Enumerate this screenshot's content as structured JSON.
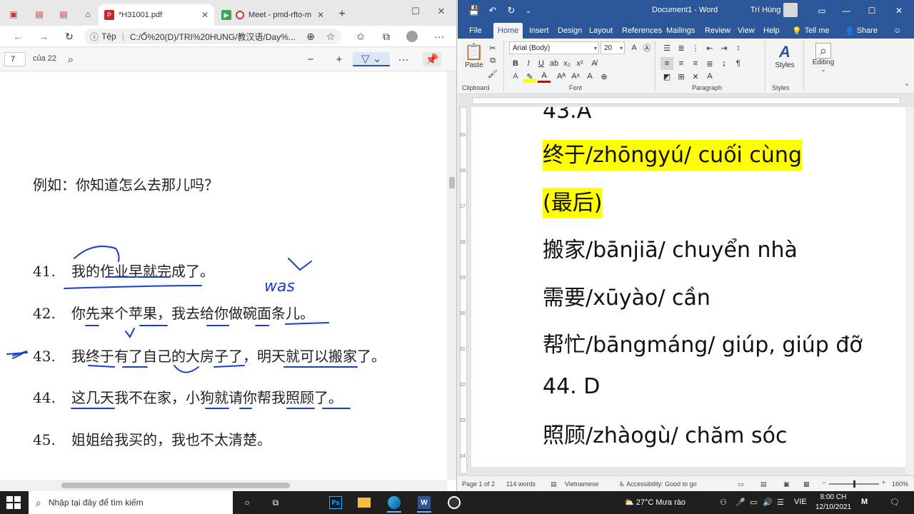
{
  "browser": {
    "tabs": [
      {
        "label": "*H31001.pdf",
        "active": true
      },
      {
        "label": "Meet - pmd-rfto-m",
        "active": false
      }
    ],
    "new_tab": "+",
    "address": {
      "label": "Tệp",
      "url": "C:/Ổ%20(D)/TRI%20HUNG/教汉语/Day%..."
    },
    "pdf": {
      "page_number": "7",
      "page_total": "của 22",
      "lines": [
        {
          "num": "",
          "text": "例如：你知道怎么去那儿吗？"
        },
        {
          "num": "41.",
          "text": "我的作业早就完成了。"
        },
        {
          "num": "42.",
          "text": "你先来个苹果，我去给你做碗面条儿。"
        },
        {
          "num": "43.",
          "text": "我终于有了自己的大房子了，明天就可以搬家了。"
        },
        {
          "num": "44.",
          "text": "这几天我不在家，小狗就请你帮我照顾了。"
        },
        {
          "num": "45.",
          "text": "姐姐给我买的，我也不太清楚。"
        }
      ],
      "handwriting": "was"
    }
  },
  "word": {
    "title": "Document1 - Word",
    "user": "Trí Hùng",
    "tabs": [
      "File",
      "Home",
      "Insert",
      "Design",
      "Layout",
      "References",
      "Mailings",
      "Review",
      "View",
      "Help",
      "Tell me",
      "Share"
    ],
    "font_name": "Arial (Body)",
    "font_size": "20",
    "groups": [
      "Clipboard",
      "Font",
      "Paragraph",
      "Styles"
    ],
    "paste_label": "Paste",
    "styles_label": "Styles",
    "editing_label": "Editing",
    "ruler_numbers": [
      "15",
      "16",
      "17",
      "18",
      "19",
      "20",
      "21",
      "22",
      "23",
      "24"
    ],
    "document_lines": [
      {
        "text": "43.A",
        "highlight": false
      },
      {
        "text": "终于/zhōngyú/ cuối cùng",
        "highlight": true
      },
      {
        "text": "(最后)",
        "highlight": true
      },
      {
        "text": "搬家/bānjiā/ chuyển nhà",
        "highlight": false
      },
      {
        "text": "需要/xūyào/ cần",
        "highlight": false
      },
      {
        "text": "帮忙/bāngmáng/ giúp, giúp đỡ",
        "highlight": false
      },
      {
        "text": "44. D",
        "highlight": false
      },
      {
        "text": "照顾/zhàogù/ chăm sóc",
        "highlight": false
      }
    ],
    "status": {
      "page": "Page 1 of 2",
      "words": "114 words",
      "language": "Vietnamese",
      "accessibility": "Accessibility: Good to go",
      "zoom": "160%"
    },
    "highlight_color": "#ffff00",
    "brand_color": "#2b579a"
  },
  "taskbar": {
    "search_placeholder": "Nhập tại đây để tìm kiếm",
    "weather": "27°C  Mưa rào",
    "lang": "VIE",
    "time": "8:00 CH",
    "date": "12/10/2021"
  }
}
